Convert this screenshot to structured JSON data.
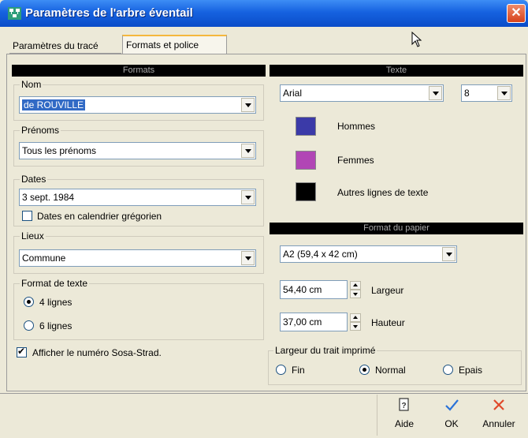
{
  "window": {
    "title": "Paramètres de l'arbre éventail",
    "close_glyph": "✕"
  },
  "tabs": [
    {
      "label": "Paramètres du tracé"
    },
    {
      "label": "Formats et police"
    }
  ],
  "formats": {
    "header": "Formats",
    "nom": {
      "label": "Nom",
      "value": "de ROUVILLE"
    },
    "prenoms": {
      "label": "Prénoms",
      "value": "Tous les prénoms"
    },
    "dates": {
      "label": "Dates",
      "value": "3 sept. 1984",
      "checkbox_label": "Dates en calendrier grégorien",
      "checkbox_checked": false
    },
    "lieux": {
      "label": "Lieux",
      "value": "Commune"
    },
    "format_texte": {
      "label": "Format de texte",
      "option_4": "4 lignes",
      "option_6": "6 lignes",
      "selected": "4 lignes"
    },
    "sosa": {
      "label": "Afficher le numéro Sosa-Strad.",
      "checked": true
    }
  },
  "texte": {
    "header": "Texte",
    "font": "Arial",
    "size": "8",
    "hommes_label": "Hommes",
    "femmes_label": "Femmes",
    "autres_label": "Autres lignes de texte",
    "colors": {
      "hommes": "#3B3AA8",
      "femmes": "#B146B5",
      "autres": "#000000"
    }
  },
  "papier": {
    "header": "Format du papier",
    "format": "A2 (59,4 x 42  cm)",
    "largeur_value": "54,40 cm",
    "largeur_label": "Largeur",
    "hauteur_value": "37,00 cm",
    "hauteur_label": "Hauteur"
  },
  "trait": {
    "label": "Largeur du trait imprimé",
    "fin": "Fin",
    "normal": "Normal",
    "epais": "Epais",
    "selected": "Normal"
  },
  "footer": {
    "aide": "Aide",
    "ok": "OK",
    "annuler": "Annuler"
  }
}
